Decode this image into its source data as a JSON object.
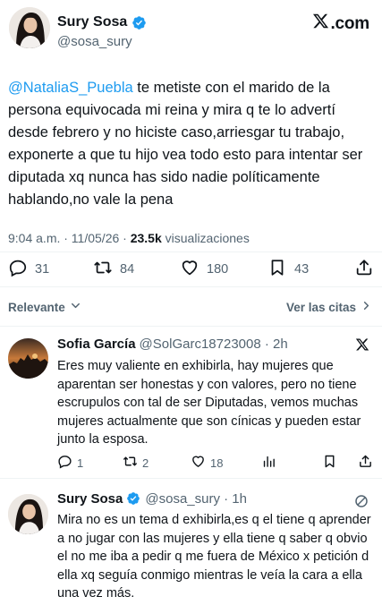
{
  "post": {
    "author_name": "Sury Sosa",
    "author_handle": "@sosa_sury",
    "brand": ".com",
    "mention": "@NataliaS_Puebla",
    "text": " te metiste con el marido de la persona equivocada mi reina y mira q te lo advertí desde febrero y no hiciste caso,arriesgar tu trabajo, exponerte a que tu hijo vea todo esto para intentar ser diputada xq nunca has sido nadie políticamente hablando,no vale la pena",
    "time": "9:04 a.m. · 11/05/26 · ",
    "views_count": "23.5k",
    "views_label": " visualizaciones",
    "replies": "31",
    "reposts": "84",
    "likes": "180",
    "bookmarks": "43"
  },
  "sort": {
    "left_label": "Relevante",
    "right_label": "Ver las citas"
  },
  "replies": [
    {
      "name": "Sofia García",
      "handle": "@SolGarc18723008 · 2h",
      "text": "Eres muy valiente en exhibirla, hay mujeres que aparentan ser honestas y con valores, pero no tiene escrupulos con tal de ser Diputadas, vemos muchas mujeres actualmente que son cínicas y pueden estar junto la esposa.",
      "replies": "1",
      "reposts": "2",
      "likes": "18"
    },
    {
      "name": "Sury Sosa",
      "handle": "@sosa_sury · 1h",
      "text": "Mira no es un tema d exhibirla,es q el tiene q aprender a no jugar con las mujeres y ella tiene q saber q obvio el no me iba a pedir q me fuera de México x petición d ella  xq seguía conmigo mientras le veía la cara a ella una vez más."
    }
  ],
  "colors": {
    "accent": "#1d9bf0",
    "text": "#0f1419",
    "secondary": "#536471",
    "verified": "#1d9bf0"
  }
}
